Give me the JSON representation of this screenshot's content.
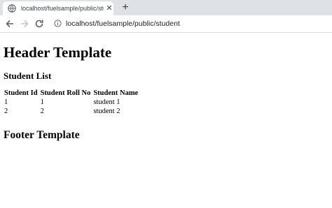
{
  "browser": {
    "tab": {
      "title": "localhost/fuelsample/public/stu"
    },
    "new_tab_symbol": "+",
    "close_symbol": "✕",
    "address": "localhost/fuelsample/public/student"
  },
  "page": {
    "header": "Header Template",
    "subheading": "Student List",
    "table": {
      "columns": [
        "Student Id",
        "Student Roll No",
        "Student Name"
      ],
      "rows": [
        [
          "1",
          "1",
          "student 1"
        ],
        [
          "2",
          "2",
          "student 2"
        ]
      ]
    },
    "footer": "Footer Template"
  }
}
